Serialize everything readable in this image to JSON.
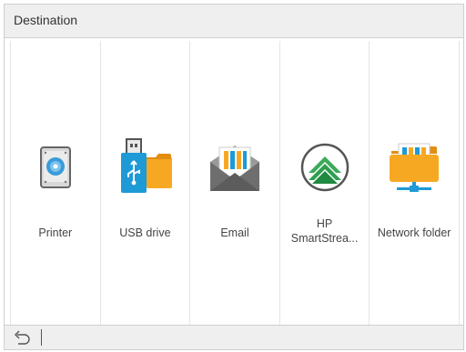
{
  "header": {
    "title": "Destination"
  },
  "tiles": [
    {
      "label": "Printer",
      "icon": "printer-icon"
    },
    {
      "label": "USB drive",
      "icon": "usb-drive-icon"
    },
    {
      "label": "Email",
      "icon": "email-icon"
    },
    {
      "label": "HP SmartStrea...",
      "line1": "HP",
      "line2": "SmartStrea...",
      "icon": "hp-smartstream-icon"
    },
    {
      "label": "Network folder",
      "icon": "network-folder-icon"
    }
  ],
  "footer": {
    "back_icon": "back-arrow-icon"
  },
  "colors": {
    "header_bg": "#efefef",
    "usb_blue": "#1e9ad6",
    "folder_orange": "#f7a823",
    "smartstream_green": "#2f9e4f"
  }
}
